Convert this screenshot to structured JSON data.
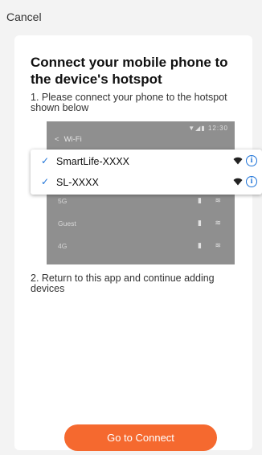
{
  "header": {
    "cancel_label": "Cancel"
  },
  "main": {
    "title": "Connect your mobile phone to the device's hotspot",
    "step1": "1. Please connect your phone to the hotspot shown below",
    "step2": "2. Return to this app and continue adding devices",
    "button_label": "Go to Connect",
    "accent_color": "#f5692f"
  },
  "illustration": {
    "status_time": "12:30",
    "header_back": "<",
    "header_title": "Wi-Fi",
    "networks": [
      {
        "name": "SmartLife-XXXX",
        "checked": true,
        "icon": "wifi-icon",
        "info_icon": "info-icon"
      },
      {
        "name": "SL-XXXX",
        "checked": true,
        "icon": "wifi-icon",
        "info_icon": "info-icon"
      }
    ],
    "background_networks": [
      {
        "name": "5G"
      },
      {
        "name": "Guest"
      },
      {
        "name": "4G"
      }
    ],
    "check_color": "#1e73d8"
  }
}
